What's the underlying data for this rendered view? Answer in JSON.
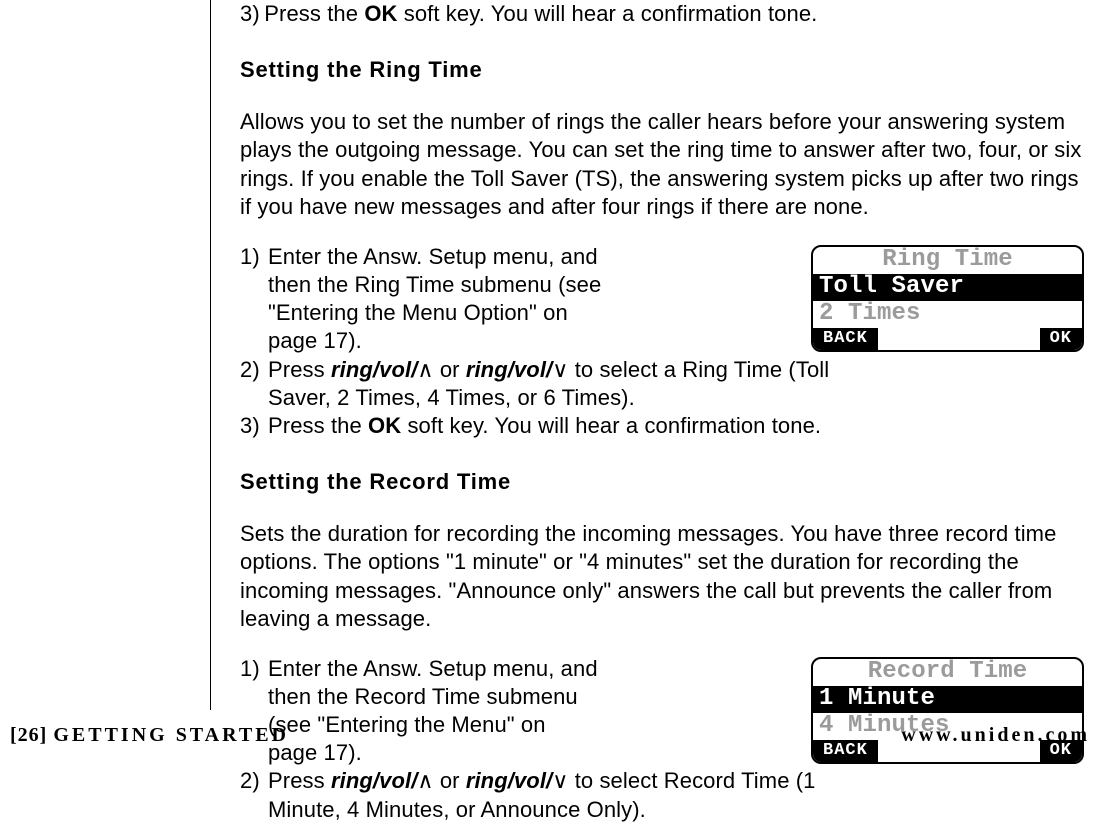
{
  "top_trail": {
    "pre": "3) Press the ",
    "ok": "OK",
    "post": " soft key. You will hear a confirmation tone."
  },
  "h1_ringtime": "Setting the Ring Time",
  "ringtime_desc": "Allows you to set the number of rings the caller hears before your answering system plays the outgoing message. You can set the ring time to answer after two, four, or six rings. If you enable the Toll Saver (TS), the answering system picks up after two rings if you have new messages and after four rings if there are none.",
  "ringtime_steps": {
    "s1": {
      "n": "1)",
      "t": "Enter the Answ. Setup menu, and then the Ring Time submenu (see \"Entering the Menu Option\" on page 17)."
    },
    "s2": {
      "n": "2)",
      "pre": "Press ",
      "rv1": "ring/vol/",
      "up": "∧",
      "mid": " or ",
      "rv2": "ring/vol/",
      "down": "∨",
      "post": " to select a Ring Time (Toll Saver, 2 Times, 4 Times, or 6 Times)."
    },
    "s3": {
      "n": "3)",
      "pre": "Press the ",
      "ok": "OK",
      "post": " soft key. You will hear a confirmation tone."
    }
  },
  "lcd_ring": {
    "title": "Ring Time",
    "sel": "Toll Saver ",
    "line": "2 Times",
    "back": "BACK",
    "ok": "OK"
  },
  "h1_rectime": "Setting the Record Time",
  "rectime_desc": "Sets the duration for recording the incoming messages. You have three record time options. The options \"1 minute\" or \"4 minutes\" set the duration for recording the incoming messages. \"Announce only\" answers the call but prevents the caller from leaving a message.",
  "rectime_steps": {
    "s1": {
      "n": "1)",
      "t": "Enter the Answ. Setup menu, and then the Record Time submenu (see \"Entering the Menu\" on page 17)."
    },
    "s2": {
      "n": "2)",
      "pre": "Press ",
      "rv1": "ring/vol/",
      "up": "∧",
      "mid": " or ",
      "rv2": "ring/vol/",
      "down": "∨",
      "post": " to select Record Time (1 Minute, 4 Minutes, or Announce Only)."
    }
  },
  "lcd_rec": {
    "title": "Record Time",
    "sel": "1 Minute   ",
    "line": "4 Minutes",
    "back": "BACK",
    "ok": "OK"
  },
  "footer": {
    "page_prefix": "[26] ",
    "section": "GETTING STARTED",
    "url": "www.uniden.com"
  }
}
